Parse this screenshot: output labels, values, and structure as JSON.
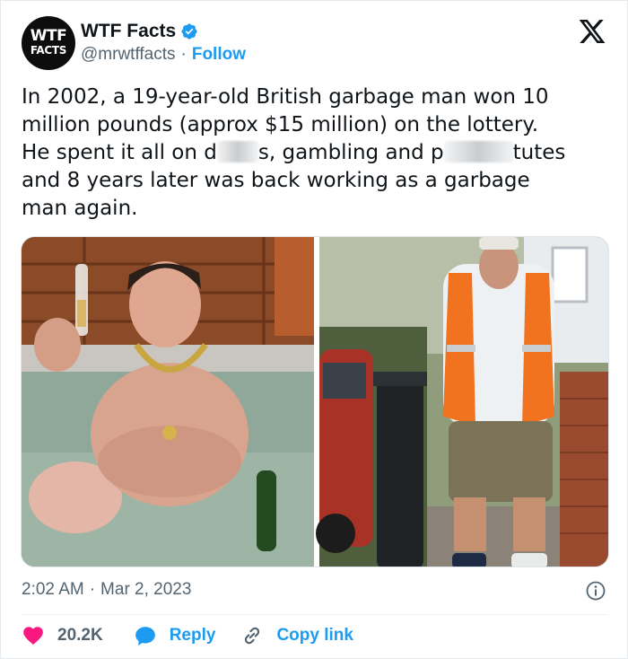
{
  "author": {
    "avatar_text_line1": "WTF",
    "avatar_text_line2": "FACTS",
    "name": "WTF Facts",
    "handle": "@mrwtffacts",
    "separator": "·",
    "follow_label": "Follow"
  },
  "tweet": {
    "line1": "In 2002, a 19-year-old British garbage man won 10",
    "line2": "million pounds (approx $15 million) on the lottery.",
    "line3_a": "He spent it all on d",
    "line3_b": "s, gambling and p",
    "line3_c": "tutes",
    "line4": "and 8 years later was back working as a garbage",
    "line5": "man again."
  },
  "meta": {
    "time": "2:02 AM",
    "separator": "·",
    "date": "Mar 2, 2023"
  },
  "actions": {
    "likes": "20.2K",
    "reply": "Reply",
    "copy_link": "Copy link"
  },
  "colors": {
    "accent": "#1d9bf0",
    "like": "#f91880",
    "text": "#0f1419",
    "secondary": "#536471"
  },
  "icons": {
    "verified": "verified-badge-icon",
    "platform": "x-logo-icon",
    "info": "info-icon",
    "like": "heart-icon",
    "reply": "speech-bubble-icon",
    "copy": "link-icon"
  }
}
